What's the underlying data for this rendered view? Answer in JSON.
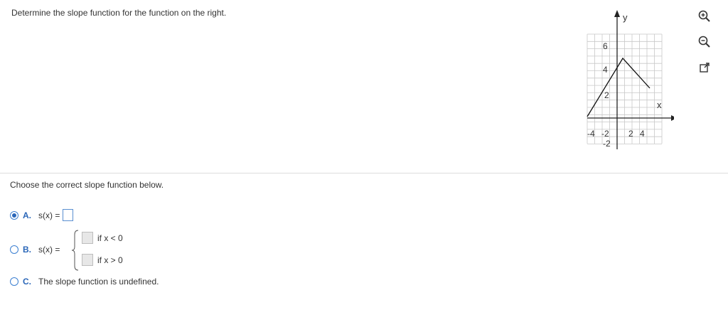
{
  "question": "Determine the slope function for the function on the right.",
  "graph": {
    "x_axis_label": "x",
    "y_axis_label": "y",
    "x_ticks": [
      "-4",
      "-2",
      "2",
      "4"
    ],
    "y_ticks": [
      "6",
      "4",
      "2",
      "-2"
    ]
  },
  "tools": [
    "zoom-in-icon",
    "zoom-out-icon",
    "popout-icon"
  ],
  "prompt": "Choose the correct slope function below.",
  "options": {
    "a": {
      "letter": "A.",
      "text": "s(x) =",
      "selected": true
    },
    "b": {
      "letter": "B.",
      "text": "s(x) =",
      "cond1": "if x < 0",
      "cond2": "if x > 0",
      "selected": false
    },
    "c": {
      "letter": "C.",
      "text": "The slope function is undefined.",
      "selected": false
    }
  },
  "colors": {
    "accent": "#2a66b8",
    "grid": "#c8c8c8"
  }
}
